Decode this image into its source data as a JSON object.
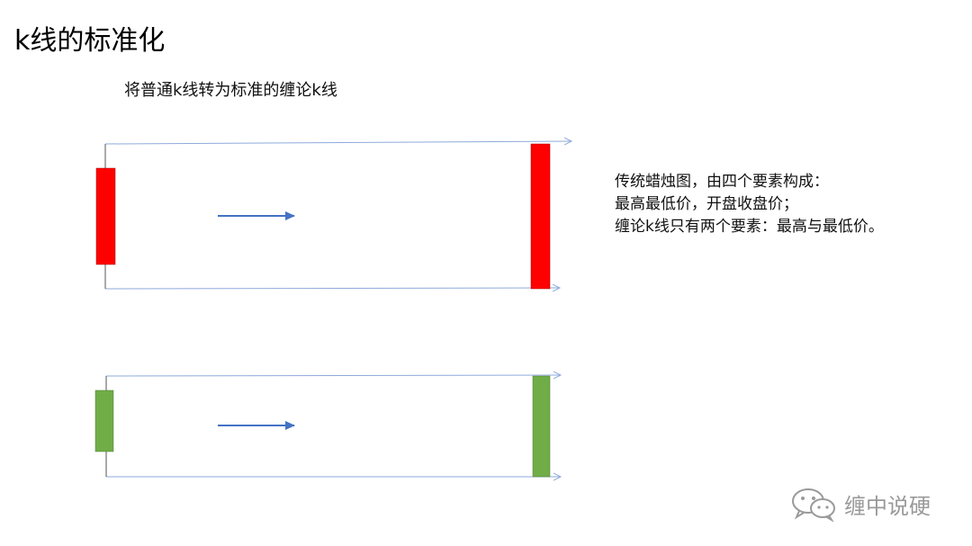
{
  "title": "k线的标准化",
  "subtitle": "将普通k线转为标准的缠论k线",
  "description": {
    "lines": [
      "传统蜡烛图，由四个要素构成：",
      "最高最低价，开盘收盘价；",
      "缠论k线只有两个要素：最高与最低价。"
    ]
  },
  "colors": {
    "bullish": "#ff0000",
    "bearish": "#70ad47",
    "arrow": "#4472c4",
    "guide": "#8eaadb"
  },
  "watermark": {
    "icon": "wechat-icon",
    "text": "缠中说硬"
  }
}
